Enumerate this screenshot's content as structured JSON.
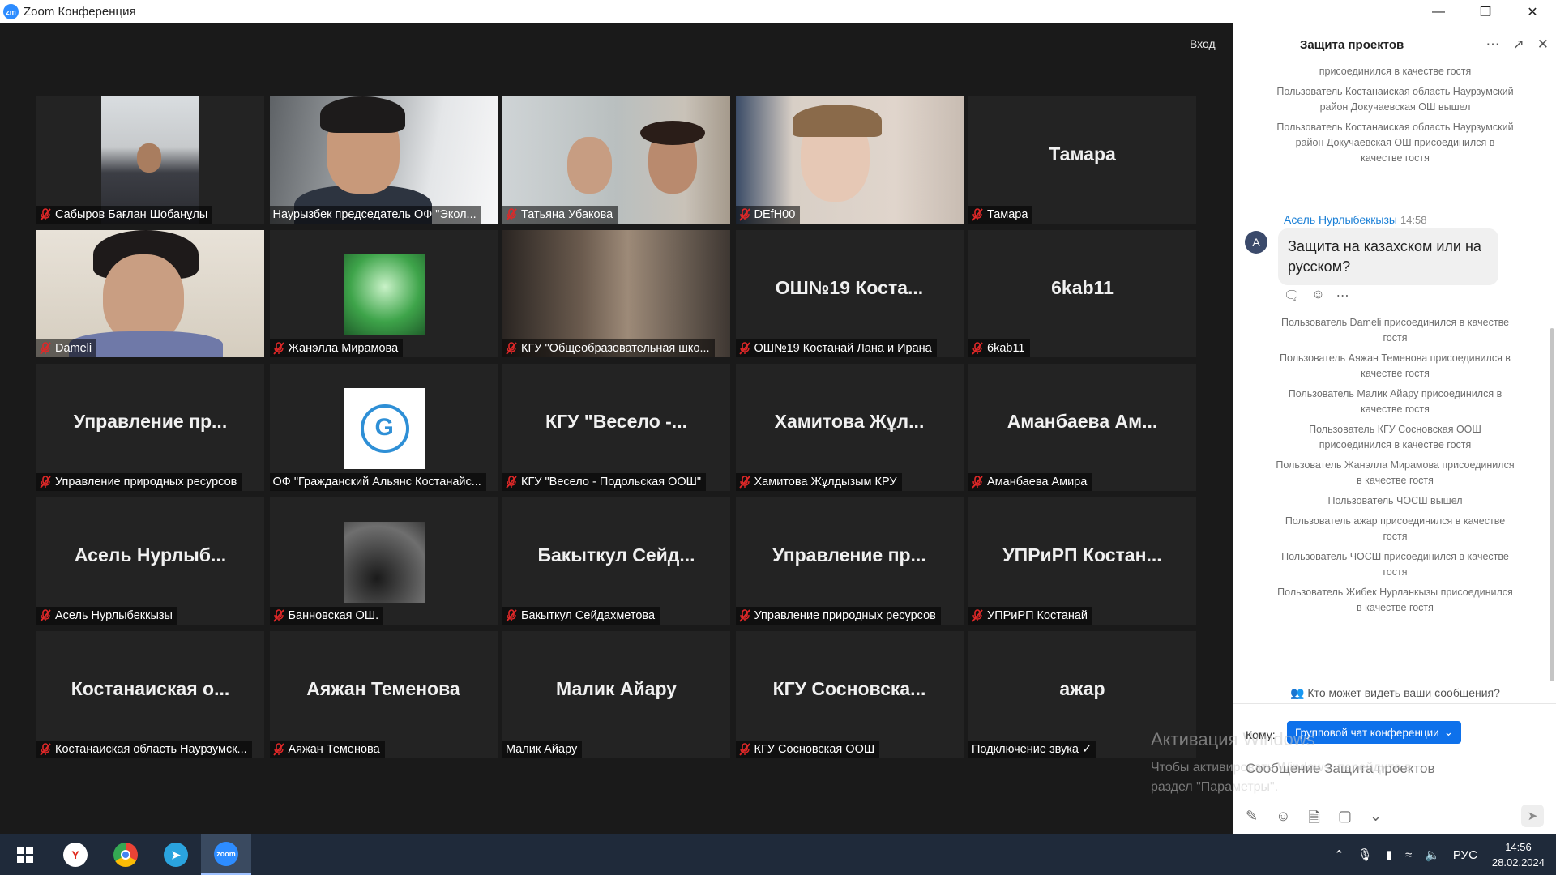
{
  "window": {
    "title": "Zoom Конференция",
    "logo": "zm"
  },
  "video": {
    "enter_label": "Вход",
    "tiles": [
      {
        "label": "Сабыров Бағлан Шобанұлы",
        "muted": true,
        "kind": "office"
      },
      {
        "label": "Наурызбек председатель ОФ \"Экол...",
        "muted": false,
        "kind": "man",
        "active": true
      },
      {
        "label": "Татьяна Убакова",
        "muted": true,
        "kind": "girls"
      },
      {
        "label": "DEfH00",
        "muted": true,
        "kind": "teen"
      },
      {
        "label": "Тамара",
        "muted": true,
        "center": "Тамара"
      },
      {
        "label": "Dameli",
        "muted": true,
        "kind": "woman"
      },
      {
        "label": "Жанэлла Мирамова",
        "muted": true,
        "kind": "robot"
      },
      {
        "label": "КГУ \"Общеобразовательная шко...",
        "muted": true,
        "kind": "class"
      },
      {
        "label": "ОШ№19 Костанай Лана и Ирана",
        "muted": true,
        "center": "ОШ№19 Коста..."
      },
      {
        "label": "6kab11",
        "muted": true,
        "center": "6kab11"
      },
      {
        "label": "Управление природных ресурсов",
        "muted": true,
        "center": "Управление пр..."
      },
      {
        "label": "ОФ \"Гражданский Альянс Костанайс...",
        "muted": false,
        "kind": "logo"
      },
      {
        "label": "КГУ \"Весело - Подольская ООШ\"",
        "muted": true,
        "center": "КГУ \"Весело -..."
      },
      {
        "label": "Хамитова Жұлдызым КРУ",
        "muted": true,
        "center": "Хамитова Жұл..."
      },
      {
        "label": "Аманбаева Амира",
        "muted": true,
        "center": "Аманбаева Ам..."
      },
      {
        "label": "Асель Нурлыбеккызы",
        "muted": true,
        "center": "Асель Нурлыб..."
      },
      {
        "label": "Банновская ОШ.",
        "muted": true,
        "kind": "dark"
      },
      {
        "label": "Бакыткул Сейдахметова",
        "muted": true,
        "center": "Бакыткул Сейд..."
      },
      {
        "label": "Управление природных ресурсов",
        "muted": true,
        "center": "Управление пр..."
      },
      {
        "label": "УПРиРП Костанай",
        "muted": true,
        "center": "УПРиРП Костан..."
      },
      {
        "label": "Костанаиская область Наурзумск...",
        "muted": true,
        "center": "Костанаиская о..."
      },
      {
        "label": "Аяжан Теменова",
        "muted": true,
        "center": "Аяжан Теменова"
      },
      {
        "label": "Малик Айару",
        "muted": false,
        "center": "Малик Айару"
      },
      {
        "label": "КГУ Сосновская ООШ",
        "muted": true,
        "center": "КГУ Сосновска..."
      },
      {
        "label": "Подключение звука ✓",
        "muted": false,
        "center": "ажар"
      }
    ]
  },
  "chat": {
    "title": "Защита проектов",
    "system_top": [
      "присоединился в качестве гостя",
      "Пользователь Костанаиская область Наурзумский район Докучаевская ОШ вышел",
      "Пользователь Костанаиская область Наурзумский район Докучаевская ОШ присоединился в качестве гостя"
    ],
    "message": {
      "sender": "Асель Нурлыбеккызы",
      "time": "14:58",
      "avatar_letter": "A",
      "text": "Защита на казахском или на русском?"
    },
    "system_bottom": [
      "Пользователь Dameli присоединился в качестве гостя",
      "Пользователь Аяжан Теменова присоединился в качестве гостя",
      "Пользователь Малик Айару присоединился в качестве гостя",
      "Пользователь КГУ Сосновская ООШ присоединился в качестве гостя",
      "Пользователь Жанэлла Мирамова присоединился в качестве гостя",
      "Пользователь ЧОСШ вышел",
      "Пользователь ажар присоединился в качестве гостя",
      "Пользователь ЧОСШ присоединился в качестве гостя",
      "Пользователь Жибек Нурланкызы присоединился в качестве гостя"
    ],
    "who_sees": "Кто может видеть ваши сообщения?",
    "to_label": "Кому:",
    "to_value": "Групповой чат конференции",
    "input_placeholder": "Сообщение Защита проектов"
  },
  "watermark": {
    "title": "Активация Windows",
    "text": "Чтобы активировать Windows, перейдите в раздел \"Параметры\"."
  },
  "taskbar": {
    "lang": "РУС",
    "time": "14:56",
    "date": "28.02.2024"
  },
  "colors": {
    "accent": "#0e71eb",
    "active_speaker": "#c8e04a",
    "muted": "#e02828",
    "taskbar": "#1f2a3a"
  }
}
